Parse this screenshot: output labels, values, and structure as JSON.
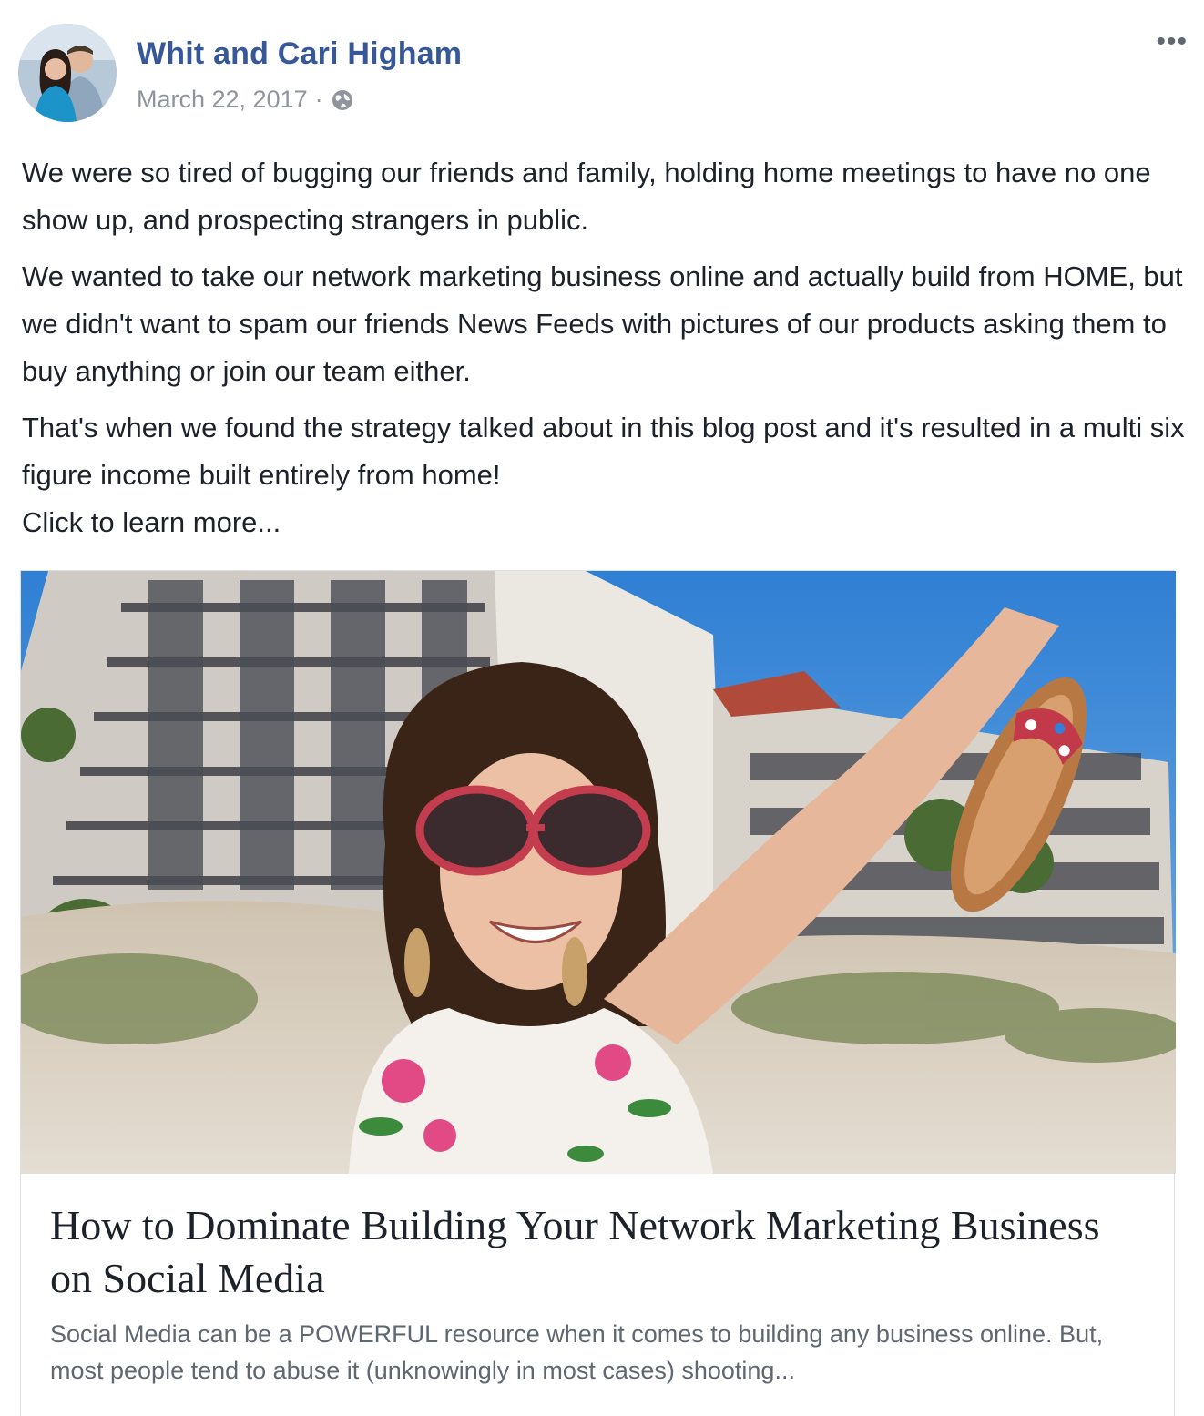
{
  "post": {
    "author": "Whit and Cari Higham",
    "date": "March 22, 2017",
    "separator": "·",
    "more_label": "•••",
    "paragraphs": [
      "We were so tired of bugging our friends and family, holding home meetings to have no one show up, and prospecting strangers in public.",
      "We wanted to take our network marketing business online and actually build from HOME, but we didn't want to spam our friends News Feeds with pictures of our products asking them to buy anything or join our team either.",
      "That's when we found the strategy talked about in this blog post and it's resulted in a multi six figure income built entirely from home!",
      "Click to learn more..."
    ]
  },
  "link_card": {
    "title": "How to Dominate Building Your Network Marketing Business on Social Media",
    "description": "Social Media can be a POWERFUL resource when it comes to building any business online. But, most people tend to abuse it (unknowingly in most cases) shooting..."
  },
  "icons": {
    "globe": "globe-icon",
    "more": "more-options-icon"
  },
  "colors": {
    "author_link": "#365899",
    "meta_text": "#90949c",
    "body_text": "#1d2129"
  }
}
